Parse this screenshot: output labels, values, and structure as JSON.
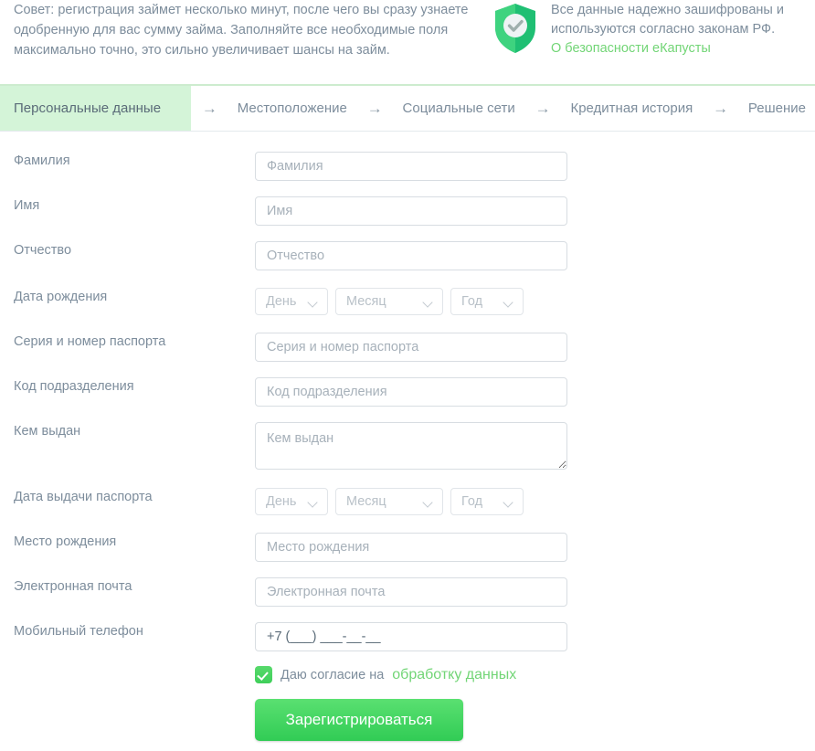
{
  "tip": {
    "text": "Совет: регистрация займет несколько минут, после чего вы сразу узнаете одобренную для вас сумму займа. Заполняйте все необходимые поля максимально точно, это сильно увеличивает шансы на займ."
  },
  "security": {
    "icon": "shield-check-icon",
    "line1": "Все данные надежно зашифрованы и",
    "line2": "используются согласно законам РФ.",
    "link": "О безопасности еКапусты",
    "link_color": "#72d576"
  },
  "tabs": {
    "arrow": "→",
    "items": [
      {
        "label": "Персональные данные",
        "active": true
      },
      {
        "label": "Местоположение",
        "active": false
      },
      {
        "label": "Социальные сети",
        "active": false
      },
      {
        "label": "Кредитная история",
        "active": false
      },
      {
        "label": "Решение",
        "active": false
      }
    ],
    "active_bg": "#d4f4d8",
    "border_color": "#cdeccf"
  },
  "form": {
    "fields": {
      "surname": {
        "label": "Фамилия",
        "placeholder": "Фамилия",
        "value": ""
      },
      "firstname": {
        "label": "Имя",
        "placeholder": "Имя",
        "value": ""
      },
      "patronymic": {
        "label": "Отчество",
        "placeholder": "Отчество",
        "value": ""
      },
      "birthdate": {
        "label": "Дата рождения"
      },
      "passport": {
        "label": "Серия и номер паспорта",
        "placeholder": "Серия и номер паспорта",
        "value": ""
      },
      "subdivision": {
        "label": "Код подразделения",
        "placeholder": "Код подразделения",
        "value": ""
      },
      "issuedby": {
        "label": "Кем выдан",
        "placeholder": "Кем выдан",
        "value": ""
      },
      "issuedate": {
        "label": "Дата выдачи паспорта"
      },
      "birthplace": {
        "label": "Место рождения",
        "placeholder": "Место рождения",
        "value": ""
      },
      "email": {
        "label": "Электронная почта",
        "placeholder": "Электронная почта",
        "value": ""
      },
      "phone": {
        "label": "Мобильный телефон",
        "placeholder": "+7 (___) ___-__-__",
        "value": "+7 (___) ___-__-__"
      }
    },
    "date_selects": {
      "day": "День",
      "month": "Месяц",
      "year": "Год",
      "chevron_icon": "chevron-down-icon"
    },
    "consent": {
      "checked": true,
      "checkbox_icon": "check-icon",
      "text": "Даю согласие на",
      "link": "обработку данных"
    },
    "submit": {
      "label": "Зарегистрироваться",
      "color": "#3fcf5a"
    }
  }
}
